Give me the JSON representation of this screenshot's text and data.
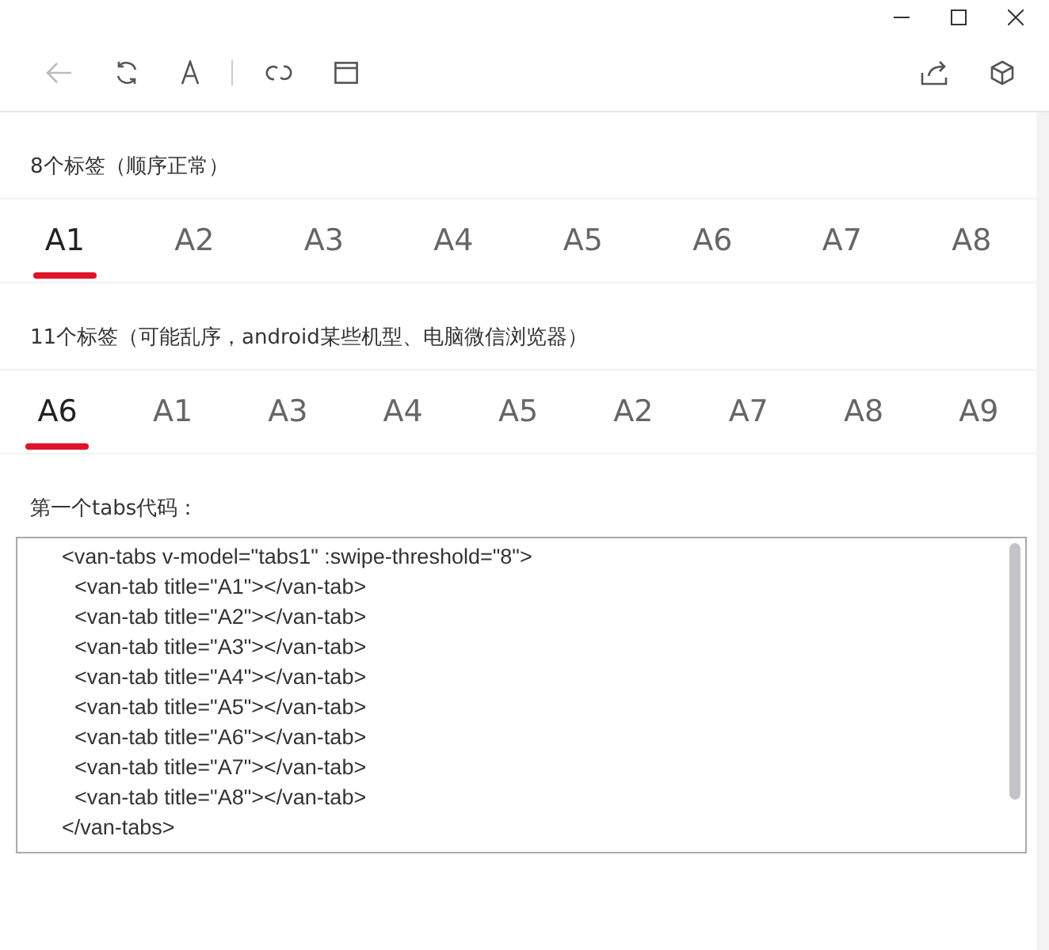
{
  "sections": [
    {
      "label": "8个标签（顺序正常）",
      "tabs": [
        {
          "label": "A1",
          "selected": true
        },
        {
          "label": "A2",
          "selected": false
        },
        {
          "label": "A3",
          "selected": false
        },
        {
          "label": "A4",
          "selected": false
        },
        {
          "label": "A5",
          "selected": false
        },
        {
          "label": "A6",
          "selected": false
        },
        {
          "label": "A7",
          "selected": false
        },
        {
          "label": "A8",
          "selected": false
        }
      ]
    },
    {
      "label": "11个标签（可能乱序，android某些机型、电脑微信浏览器）",
      "tabs": [
        {
          "label": "A6",
          "selected": true
        },
        {
          "label": "A1",
          "selected": false
        },
        {
          "label": "A3",
          "selected": false
        },
        {
          "label": "A4",
          "selected": false
        },
        {
          "label": "A5",
          "selected": false
        },
        {
          "label": "A2",
          "selected": false
        },
        {
          "label": "A7",
          "selected": false
        },
        {
          "label": "A8",
          "selected": false
        },
        {
          "label": "A9",
          "selected": false
        }
      ]
    }
  ],
  "code": {
    "label": "第一个tabs代码：",
    "lines": [
      {
        "kind": "outer",
        "text": "<van-tabs v-model=\"tabs1\" :swipe-threshold=\"8\">"
      },
      {
        "kind": "inner",
        "text": "<van-tab title=\"A1\"></van-tab>"
      },
      {
        "kind": "inner",
        "text": "<van-tab title=\"A2\"></van-tab>"
      },
      {
        "kind": "inner",
        "text": "<van-tab title=\"A3\"></van-tab>"
      },
      {
        "kind": "inner",
        "text": "<van-tab title=\"A4\"></van-tab>"
      },
      {
        "kind": "inner",
        "text": "<van-tab title=\"A5\"></van-tab>"
      },
      {
        "kind": "inner",
        "text": "<van-tab title=\"A6\"></van-tab>"
      },
      {
        "kind": "inner",
        "text": "<van-tab title=\"A7\"></van-tab>"
      },
      {
        "kind": "inner",
        "text": "<van-tab title=\"A8\"></van-tab>"
      },
      {
        "kind": "outer",
        "text": "</van-tabs>"
      }
    ]
  }
}
